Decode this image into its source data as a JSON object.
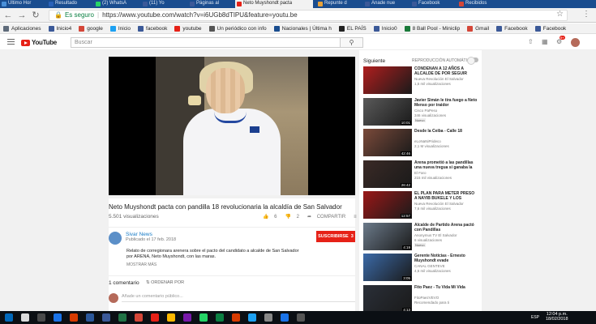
{
  "browser": {
    "tabs": [
      {
        "label": "Último Hor",
        "color": "#4a90d9",
        "active": false
      },
      {
        "label": "Resultado",
        "color": "#2a62b8",
        "active": false
      },
      {
        "label": "(2) WhatsA",
        "color": "#25d366",
        "active": false
      },
      {
        "label": "(11) Yo",
        "color": "#3b5998",
        "active": false
      },
      {
        "label": "Páginas al",
        "color": "#3b5998",
        "active": false
      },
      {
        "label": "Neto Muyshondt pacta",
        "color": "#e62117",
        "active": true
      },
      {
        "label": "Repunte d",
        "color": "#e8a23a",
        "active": false
      },
      {
        "label": "Anade nue",
        "color": "#3b5998",
        "active": false
      },
      {
        "label": "Facebook",
        "color": "#3b5998",
        "active": false
      },
      {
        "label": "Recibidos",
        "color": "#d44638",
        "active": false
      }
    ],
    "secure_label": "Es seguro",
    "url": "https://www.youtube.com/watch?v=i6UGb8dTIPU&feature=youtu.be",
    "bookmarks": [
      {
        "label": "Aplicaciones",
        "color": "#5f6b7a"
      },
      {
        "label": "Inicio4",
        "color": "#3b5998"
      },
      {
        "label": "google",
        "color": "#d44638"
      },
      {
        "label": "Inicio",
        "color": "#1da1f2"
      },
      {
        "label": "facebook",
        "color": "#3b5998"
      },
      {
        "label": "youtube",
        "color": "#e62117"
      },
      {
        "label": "Un periódico con info",
        "color": "#555555"
      },
      {
        "label": "Nacionales | Última h",
        "color": "#1a4d8f"
      },
      {
        "label": "EL PAÍS",
        "color": "#222222"
      },
      {
        "label": "Inicio0",
        "color": "#3b5998"
      },
      {
        "label": "8 Ball Pool - Miniclip",
        "color": "#1a7a3a"
      },
      {
        "label": "Gmail",
        "color": "#d44638"
      },
      {
        "label": "Facebook",
        "color": "#3b5998"
      },
      {
        "label": "Facebook",
        "color": "#3b5998"
      }
    ]
  },
  "youtube": {
    "search_placeholder": "Buscar",
    "notification_count": "9+",
    "video": {
      "title": "Neto Muyshondt pacta con pandilla 18 revolucionaria la alcaldía de San Salvador",
      "views": "5.501 visualizaciones",
      "likes": "6",
      "dislikes": "2",
      "share_label": "COMPARTIR"
    },
    "channel": {
      "name": "Sivar News",
      "published": "Publicado el 17 feb. 2018",
      "subscribe_label": "SUSCRIBIRSE",
      "subscriber_count": "3",
      "description": "Relato de corregionara arenera sobre el pacto del candidato a alcalde de San Salvador por ARENA, Neto Muyshondt, con las maras.",
      "show_more": "MOSTRAR MÁS"
    },
    "comments": {
      "count": "1 comentario",
      "sort_label": "ORDENAR POR",
      "input_placeholder": "Añade un comentario público..."
    },
    "sidebar": {
      "next_label": "Siguiente",
      "autoplay_label": "REPRODUCCIÓN AUTOMÁTICA",
      "recommendations": [
        {
          "title": "CONDENAN A 12 AÑOS A ALCALDE DE POR SEGUIR",
          "channel": "Nueva Revolución El Salvador",
          "views": "1,5 mil visualizaciones",
          "duration": "",
          "new": "",
          "thumb": "#b01e1e"
        },
        {
          "title": "Javier Simán le tira fuego a Neto Menso por traidor",
          "channel": "Cisco PaPeso",
          "views": "346 visualizaciones",
          "duration": "10:01",
          "new": "Nuevo",
          "thumb": "#5a5a5a"
        },
        {
          "title": "Desde la Ceiba - Calle 18",
          "channel": "eLoNaNiPrideco",
          "views": "2,1 M visualizaciones",
          "duration": "42:46",
          "new": "",
          "thumb": "#7a4a3a"
        },
        {
          "title": "Arena prometió a las pandillas una nueva tregua si ganaba la",
          "channel": "El Faro",
          "views": "215 mil visualizaciones",
          "duration": "26:42",
          "new": "",
          "thumb": "#3a2a26"
        },
        {
          "title": "EL PLAN PARA METER PRESO A NAYIB BUKELE Y LOS",
          "channel": "Nueva Revolución El Salvador",
          "views": "7,6 mil visualizaciones",
          "duration": "12:57",
          "new": "",
          "thumb": "#9a1818"
        },
        {
          "title": "Alcalde de Partido Arena pactó con Pandillas",
          "channel": "Anonymus TV El Salvador",
          "views": "6 visualizaciones",
          "duration": "4:19",
          "new": "Nuevo",
          "thumb": "#6b7a8a"
        },
        {
          "title": "Gerente Noticias - Ernesto Muyshondt evade",
          "channel": "CANAL GENTEVE",
          "views": "4,5 mil visualizaciones",
          "duration": "3:05",
          "new": "",
          "thumb": "#3b6aa8"
        },
        {
          "title": "Fito Paez - Tu Vida Mi Vida",
          "channel": "FitoPaezVEVO",
          "views": "Recomendado para ti",
          "duration": "4:13",
          "new": "",
          "thumb": "#2a2f38"
        }
      ]
    }
  },
  "taskbar": {
    "language": "ESP",
    "time": "12:04 p.m.",
    "date": "18/02/2018"
  }
}
